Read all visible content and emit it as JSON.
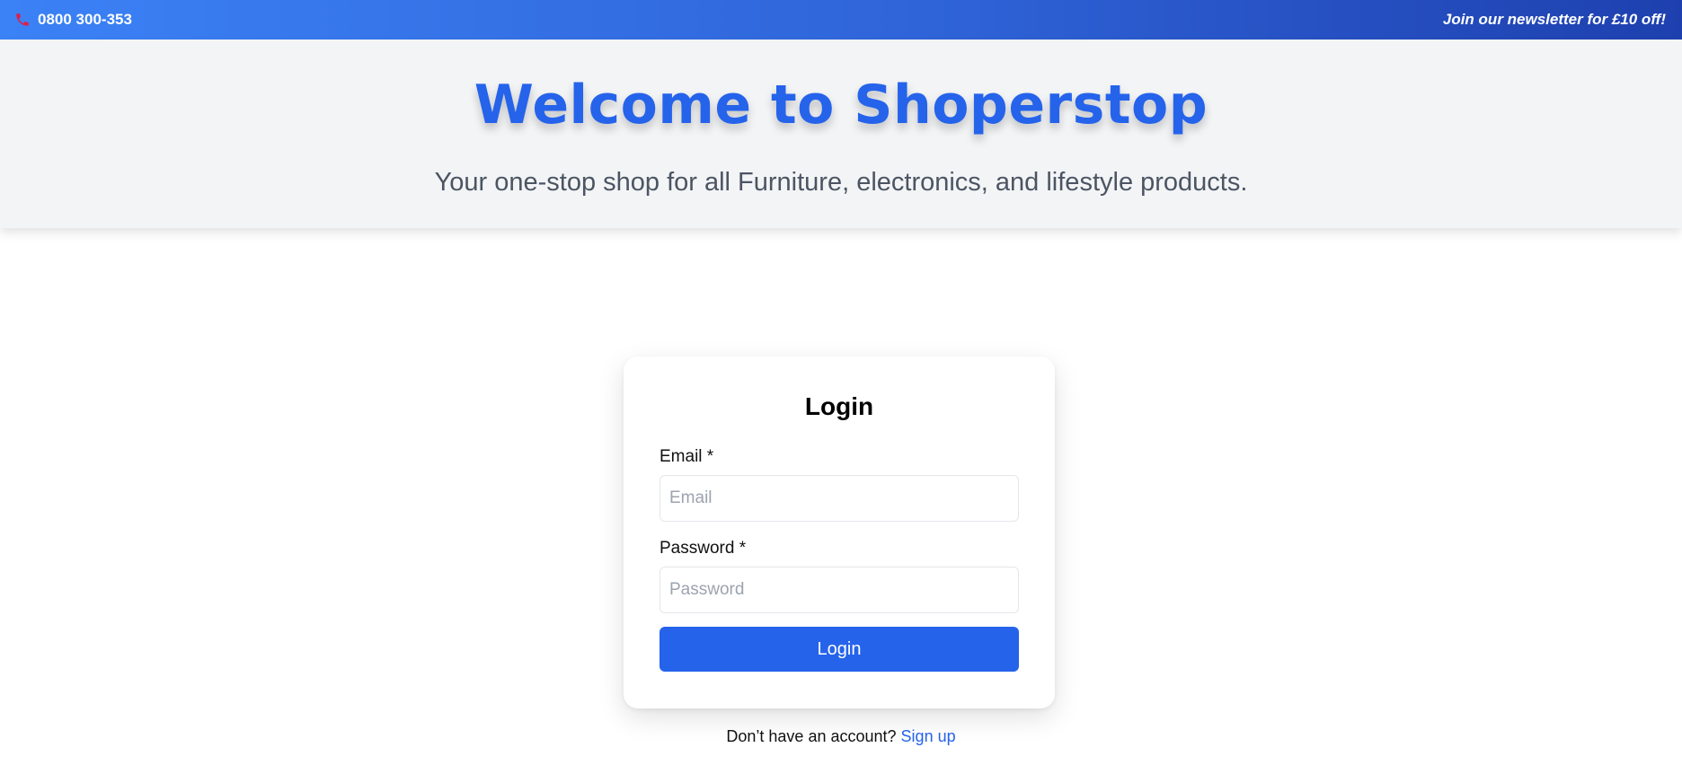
{
  "topbar": {
    "phone_number": "0800 300-353",
    "phone_icon": "phone-icon",
    "newsletter_text": "Join our newsletter for £10 off!",
    "gradient_start": "#3b82f6",
    "gradient_end": "#1e40af"
  },
  "hero": {
    "title": "Welcome to Shoperstop",
    "subtitle": "Your one-stop shop for all Furniture, electronics, and lifestyle products.",
    "title_color": "#2563eb",
    "background": "#f3f4f6"
  },
  "login_form": {
    "title": "Login",
    "email_label": "Email *",
    "email_placeholder": "Email",
    "email_value": "",
    "password_label": "Password *",
    "password_placeholder": "Password",
    "password_value": "",
    "submit_label": "Login",
    "button_color": "#2563eb"
  },
  "signup_prompt": {
    "text": "Don’t have an account?",
    "link_label": "Sign up"
  }
}
